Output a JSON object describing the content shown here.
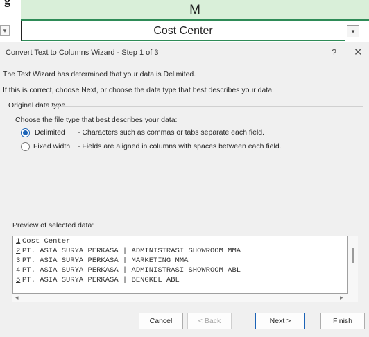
{
  "backdrop": {
    "partial_text": "g",
    "column_letter": "M",
    "cell_text": "Cost Center",
    "dropdown_glyph": "▾"
  },
  "dialog": {
    "title": "Convert Text to Columns Wizard - Step 1 of 3",
    "help_glyph": "?",
    "close_glyph": "✕",
    "line1": "The Text Wizard has determined that your data is Delimited.",
    "line2": "If this is correct, choose Next, or choose the data type that best describes your data.",
    "group_label": "Original data type",
    "choose_label": "Choose the file type that best describes your data:",
    "options": [
      {
        "label": "Delimited",
        "desc": "- Characters such as commas or tabs separate each field.",
        "checked": true
      },
      {
        "label": "Fixed width",
        "desc": "- Fields are aligned in columns with spaces between each field.",
        "checked": false
      }
    ],
    "preview_label": "Preview of selected data:",
    "preview_rows": [
      {
        "num": "1",
        "text": "Cost Center"
      },
      {
        "num": "2",
        "text": "PT. ASIA SURYA PERKASA | ADMINISTRASI SHOWROOM MMA"
      },
      {
        "num": "3",
        "text": "PT. ASIA SURYA PERKASA | MARKETING MMA"
      },
      {
        "num": "4",
        "text": "PT. ASIA SURYA PERKASA | ADMINISTRASI SHOWROOM ABL"
      },
      {
        "num": "5",
        "text": "PT. ASIA SURYA PERKASA | BENGKEL ABL"
      }
    ],
    "scroll_left": "◂",
    "scroll_right": "▸",
    "buttons": {
      "cancel": "Cancel",
      "back": "< Back",
      "next": "Next >",
      "finish": "Finish"
    }
  }
}
